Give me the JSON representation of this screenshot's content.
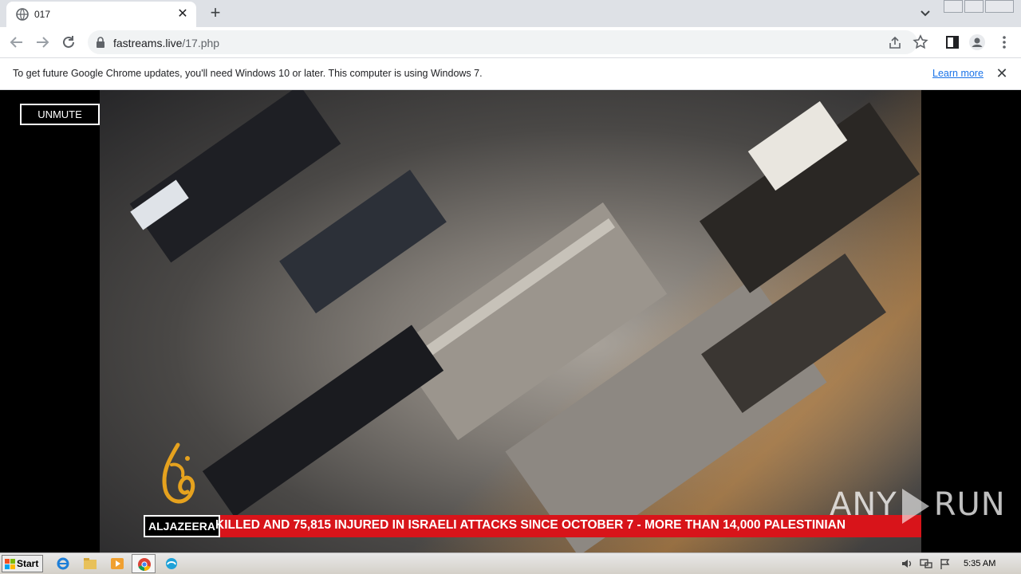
{
  "browser": {
    "tab_title": "017",
    "url_domain": "fastreams.live",
    "url_path": "/17.php",
    "infobar_message": "To get future Google Chrome updates, you'll need Windows 10 or later. This computer is using Windows 7.",
    "infobar_link": "Learn more"
  },
  "player": {
    "unmute_label": "UNMUTE",
    "ticker_brand": "ALJAZEERA",
    "ticker_text": "KILLED AND 75,815 INJURED IN ISRAELI ATTACKS SINCE OCTOBER 7   -   MORE THAN 14,000 PALESTINIAN",
    "ticker_color": "#d8141a"
  },
  "watermark": {
    "left": "ANY",
    "right": "RUN"
  },
  "taskbar": {
    "start_label": "Start",
    "clock": "5:35 AM"
  }
}
